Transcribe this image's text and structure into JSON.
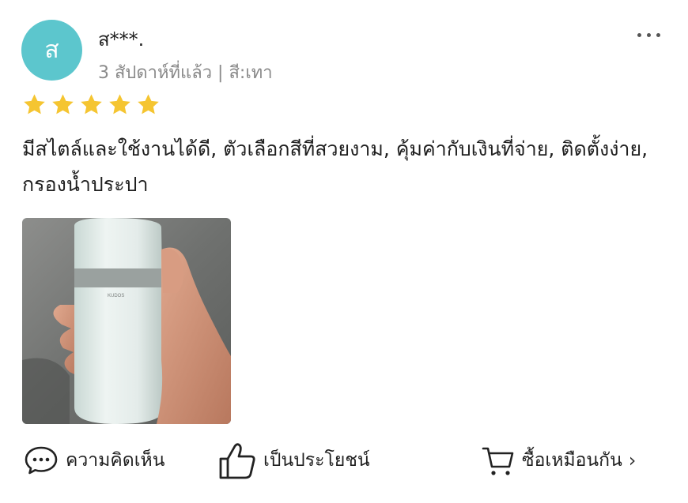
{
  "reviewer": {
    "avatar_initial": "ส",
    "avatar_color": "#5cc6cd",
    "name": "ส***.",
    "meta": "3 สัปดาห์ที่แล้ว | สี:เทา"
  },
  "rating": {
    "stars": 5,
    "max": 5,
    "star_color": "#f5c531"
  },
  "review_text": "มีสไตล์และใช้งานได้ดี, ตัวเลือกสีที่สวยงาม, คุ้มค่ากับเงินที่จ่าย, ติดตั้งง่าย, กรองน้ำประปา",
  "photo": {
    "brand_text": "KUDOS"
  },
  "actions": {
    "comment_label": "ความคิดเห็น",
    "helpful_label": "เป็นประโยชน์",
    "buy_same_label": "ซื้อเหมือนกัน"
  }
}
